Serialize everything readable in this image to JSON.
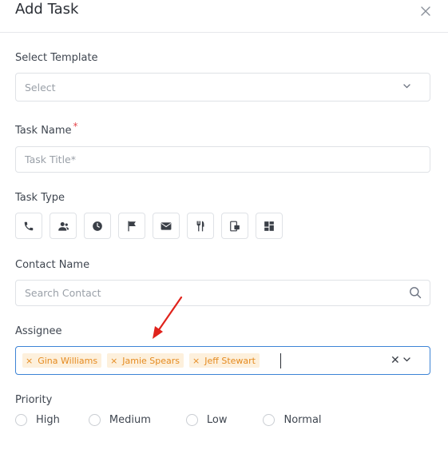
{
  "header": {
    "title": "Add Task",
    "close_icon": "close-icon"
  },
  "template": {
    "label": "Select Template",
    "placeholder": "Select"
  },
  "task_name": {
    "label": "Task Name",
    "required_mark": "*",
    "placeholder": "Task Title*"
  },
  "task_type": {
    "label": "Task Type",
    "icons": [
      "phone-icon",
      "meeting-icon",
      "clock-icon",
      "flag-icon",
      "email-icon",
      "lunch-icon",
      "transfer-icon",
      "dashboard-icon"
    ]
  },
  "contact": {
    "label": "Contact Name",
    "placeholder": "Search Contact"
  },
  "assignee": {
    "label": "Assignee",
    "tags": [
      {
        "remove": "×",
        "name": "Gina Williams"
      },
      {
        "remove": "×",
        "name": "Jamie Spears"
      },
      {
        "remove": "×",
        "name": "Jeff Stewart"
      }
    ],
    "clear": "✕"
  },
  "priority": {
    "label": "Priority",
    "options": [
      "High",
      "Medium",
      "Low",
      "Normal"
    ]
  },
  "colors": {
    "accent_border": "#3d84d6",
    "tag_bg": "#fdf0dc",
    "tag_text": "#e58a1f",
    "annotation_arrow": "#e0231c",
    "required": "#e5484d"
  }
}
